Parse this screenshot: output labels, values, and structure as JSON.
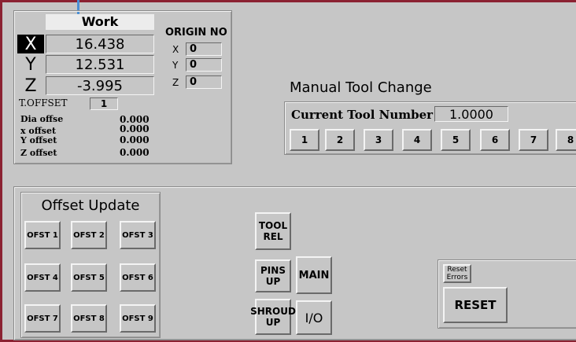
{
  "work": {
    "header": "Work",
    "axes": [
      {
        "letter": "X",
        "value": "16.438"
      },
      {
        "letter": "Y",
        "value": "12.531"
      },
      {
        "letter": "Z",
        "value": "-3.995"
      }
    ],
    "tool_offset_label": "T.OFFSET",
    "tool_offset_value": "1",
    "offsets": [
      {
        "label": "Dia offse",
        "value": "0.000"
      },
      {
        "label": "x offset",
        "value": "0.000"
      },
      {
        "label": "Y offset",
        "value": "0.000"
      },
      {
        "label": "Z offset",
        "value": "0.000"
      }
    ]
  },
  "origin": {
    "header": "ORIGIN NO",
    "rows": [
      {
        "axis": "X",
        "value": "0"
      },
      {
        "axis": "Y",
        "value": "0"
      },
      {
        "axis": "Z",
        "value": "0"
      }
    ]
  },
  "manual_tool": {
    "title": "Manual Tool Change",
    "current_label": "Current Tool Number",
    "current_value": "1.0000",
    "tools": [
      "1",
      "2",
      "3",
      "4",
      "5",
      "6",
      "7",
      "8"
    ]
  },
  "offset_update": {
    "title": "Offset Update",
    "buttons": [
      "OFST 1",
      "OFST 2",
      "OFST 3",
      "OFST 4",
      "OFST 5",
      "OFST 6",
      "OFST 7",
      "OFST 8",
      "OFST 9"
    ]
  },
  "controls": {
    "tool_rel": [
      "TOOL",
      "REL"
    ],
    "pins_up": [
      "PINS",
      "UP"
    ],
    "shroud_up": [
      "SHROUD",
      "UP"
    ],
    "main": "MAIN",
    "io": "I/O"
  },
  "reset": {
    "errors_label": [
      "Reset",
      "Errors"
    ],
    "button": "RESET"
  }
}
